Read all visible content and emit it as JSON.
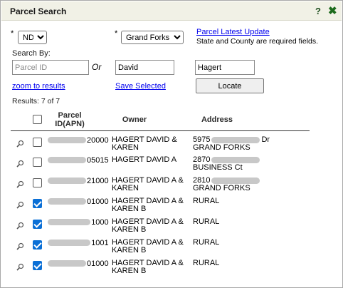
{
  "window": {
    "title": "Parcel Search",
    "help_label": "?",
    "close_label": "✖"
  },
  "form": {
    "required_mark": "*",
    "state": {
      "selected": "ND",
      "options": [
        "ND"
      ]
    },
    "county": {
      "selected": "Grand Forks",
      "options": [
        "Grand Forks"
      ]
    },
    "latest_update_link": "Parcel Latest Update",
    "required_note": "State and County are required fields.",
    "search_by_label": "Search By:",
    "parcel_id": {
      "placeholder": "Parcel ID",
      "value": ""
    },
    "or_label": "Or",
    "first_name": {
      "value": "David"
    },
    "last_name": {
      "value": "Hagert"
    },
    "zoom_link": "zoom to results",
    "save_link": "Save Selected",
    "locate_button": "Locate"
  },
  "results_label": "Results: 7 of 7",
  "table": {
    "headers": {
      "parcel": "Parcel\nID(APN)",
      "owner": "Owner",
      "address": "Address"
    },
    "rows": [
      {
        "checked": false,
        "apn_suffix": "20000",
        "owner": [
          "HAGERT DAVID &",
          "KAREN"
        ],
        "addr1_prefix": "5975",
        "addr1_suffix": "Dr",
        "addr2": "GRAND FORKS"
      },
      {
        "checked": false,
        "apn_suffix": "05015",
        "owner": [
          "HAGERT DAVID A",
          ""
        ],
        "addr1_prefix": "2870",
        "addr1_suffix": "",
        "addr2": "BUSINESS Ct"
      },
      {
        "checked": false,
        "apn_suffix": "21000",
        "owner": [
          "HAGERT DAVID A &",
          "KAREN"
        ],
        "addr1_prefix": "2810",
        "addr1_suffix": "",
        "addr2": "GRAND FORKS"
      },
      {
        "checked": true,
        "apn_suffix": "01000",
        "owner": [
          "HAGERT DAVID A &",
          "KAREN B"
        ],
        "addr1_prefix": "RURAL",
        "addr1_suffix": "",
        "addr2": ""
      },
      {
        "checked": true,
        "apn_suffix": "1000",
        "owner": [
          "HAGERT DAVID A &",
          "KAREN B"
        ],
        "addr1_prefix": "RURAL",
        "addr1_suffix": "",
        "addr2": ""
      },
      {
        "checked": true,
        "apn_suffix": "1001",
        "owner": [
          "HAGERT DAVID A &",
          "KAREN B"
        ],
        "addr1_prefix": "RURAL",
        "addr1_suffix": "",
        "addr2": ""
      },
      {
        "checked": true,
        "apn_suffix": "01000",
        "owner": [
          "HAGERT DAVID A &",
          "KAREN B"
        ],
        "addr1_prefix": "RURAL",
        "addr1_suffix": "",
        "addr2": ""
      }
    ]
  },
  "colors": {
    "titlebar": "#f1f1e6",
    "link": "#0000ee",
    "checkbox_on": "#0a6fd6",
    "close_icon": "#1d6b1d"
  }
}
